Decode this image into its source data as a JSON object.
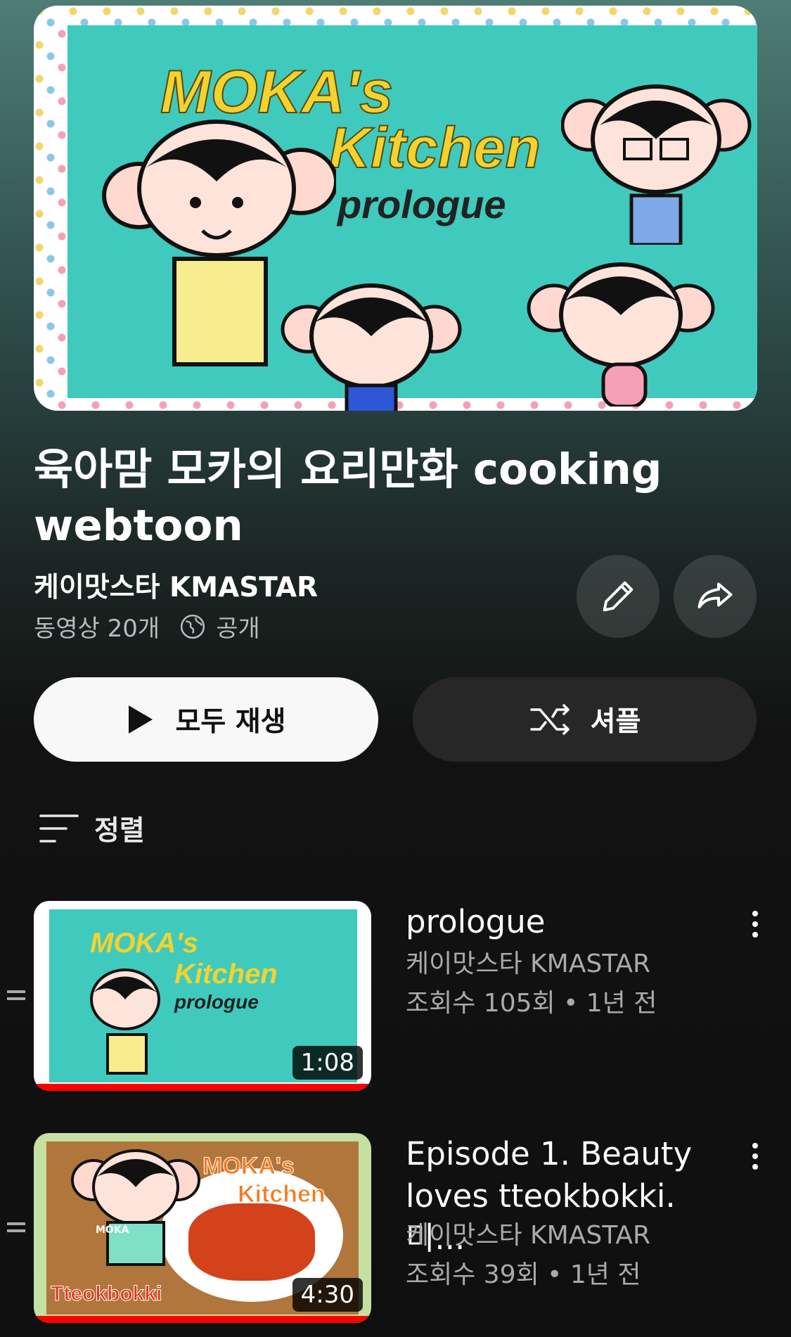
{
  "hero": {
    "title_line1": "MOKA's",
    "title_line2": "Kitchen",
    "subtitle": "prologue"
  },
  "playlist": {
    "title": "육아맘 모카의 요리만화 cooking webtoon",
    "channel": "케이맛스타 KMASTAR",
    "video_count": "동영상 20개",
    "visibility": "공개"
  },
  "actions": {
    "play_all": "모두 재생",
    "shuffle": "셔플",
    "sort": "정렬"
  },
  "videos": [
    {
      "thumb_title1": "MOKA's",
      "thumb_title2": "Kitchen",
      "thumb_sub": "prologue",
      "duration": "1:08",
      "title": "prologue",
      "channel": "케이맛스타 KMASTAR",
      "stats": "조회수 105회 • 1년 전"
    },
    {
      "thumb_title1": "MOKA's",
      "thumb_title2": "Kitchen",
      "thumb_sub": "Tteokbokki",
      "thumb_badge": "MOKA",
      "duration": "4:30",
      "title": "Episode 1. Beauty loves tteokbokki. 미...",
      "channel": "케이맛스타 KMASTAR",
      "stats": "조회수 39회 • 1년 전"
    }
  ],
  "colors": {
    "accent": "#ff0000",
    "thumb_teal": "#3fcabd",
    "title_yellow": "#f4d22f"
  }
}
